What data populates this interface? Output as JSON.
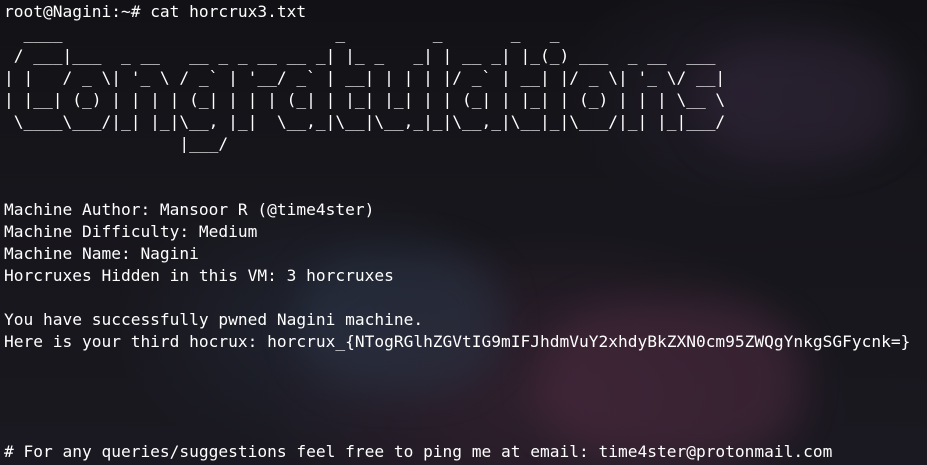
{
  "terminal": {
    "prompt": "root@Nagini:~# ",
    "command": "cat horcrux3.txt",
    "banner_lines": [
      "  ____                            _         _       _   _                 ",
      " / ___|___  _ __   __ _ _ __ __ _| |_ _   _| | __ _| |_(_) ___  _ __  ___ ",
      "| |   / _ \\| '_ \\ / _` | '__/ _` | __| | | | |/ _` | __| |/ _ \\| '_ \\/ __|",
      "| |__| (_) | | | | (_| | | | (_| | |_| |_| | | (_| | |_| | (_) | | | \\__ \\",
      " \\____\\___/|_| |_|\\__, |_|  \\__,_|\\__|\\__,_|_|\\__,_|\\__|_|\\___/|_| |_|___/",
      "                  |___/                                                    "
    ],
    "info_lines": [
      "Machine Author: Mansoor R (@time4ster)",
      "Machine Difficulty: Medium",
      "Machine Name: Nagini",
      "Horcruxes Hidden in this VM: 3 horcruxes"
    ],
    "success_line": "You have successfully pwned Nagini machine.",
    "hocrux_line": "Here is your third hocrux: horcrux_{NTogRGlhZGVtIG9mIFJhdmVuY2xhdyBkZXN0cm95ZWQgYnkgSGFycnk=}",
    "footer_line": "# For any queries/suggestions feel free to ping me at email: time4ster@protonmail.com"
  }
}
